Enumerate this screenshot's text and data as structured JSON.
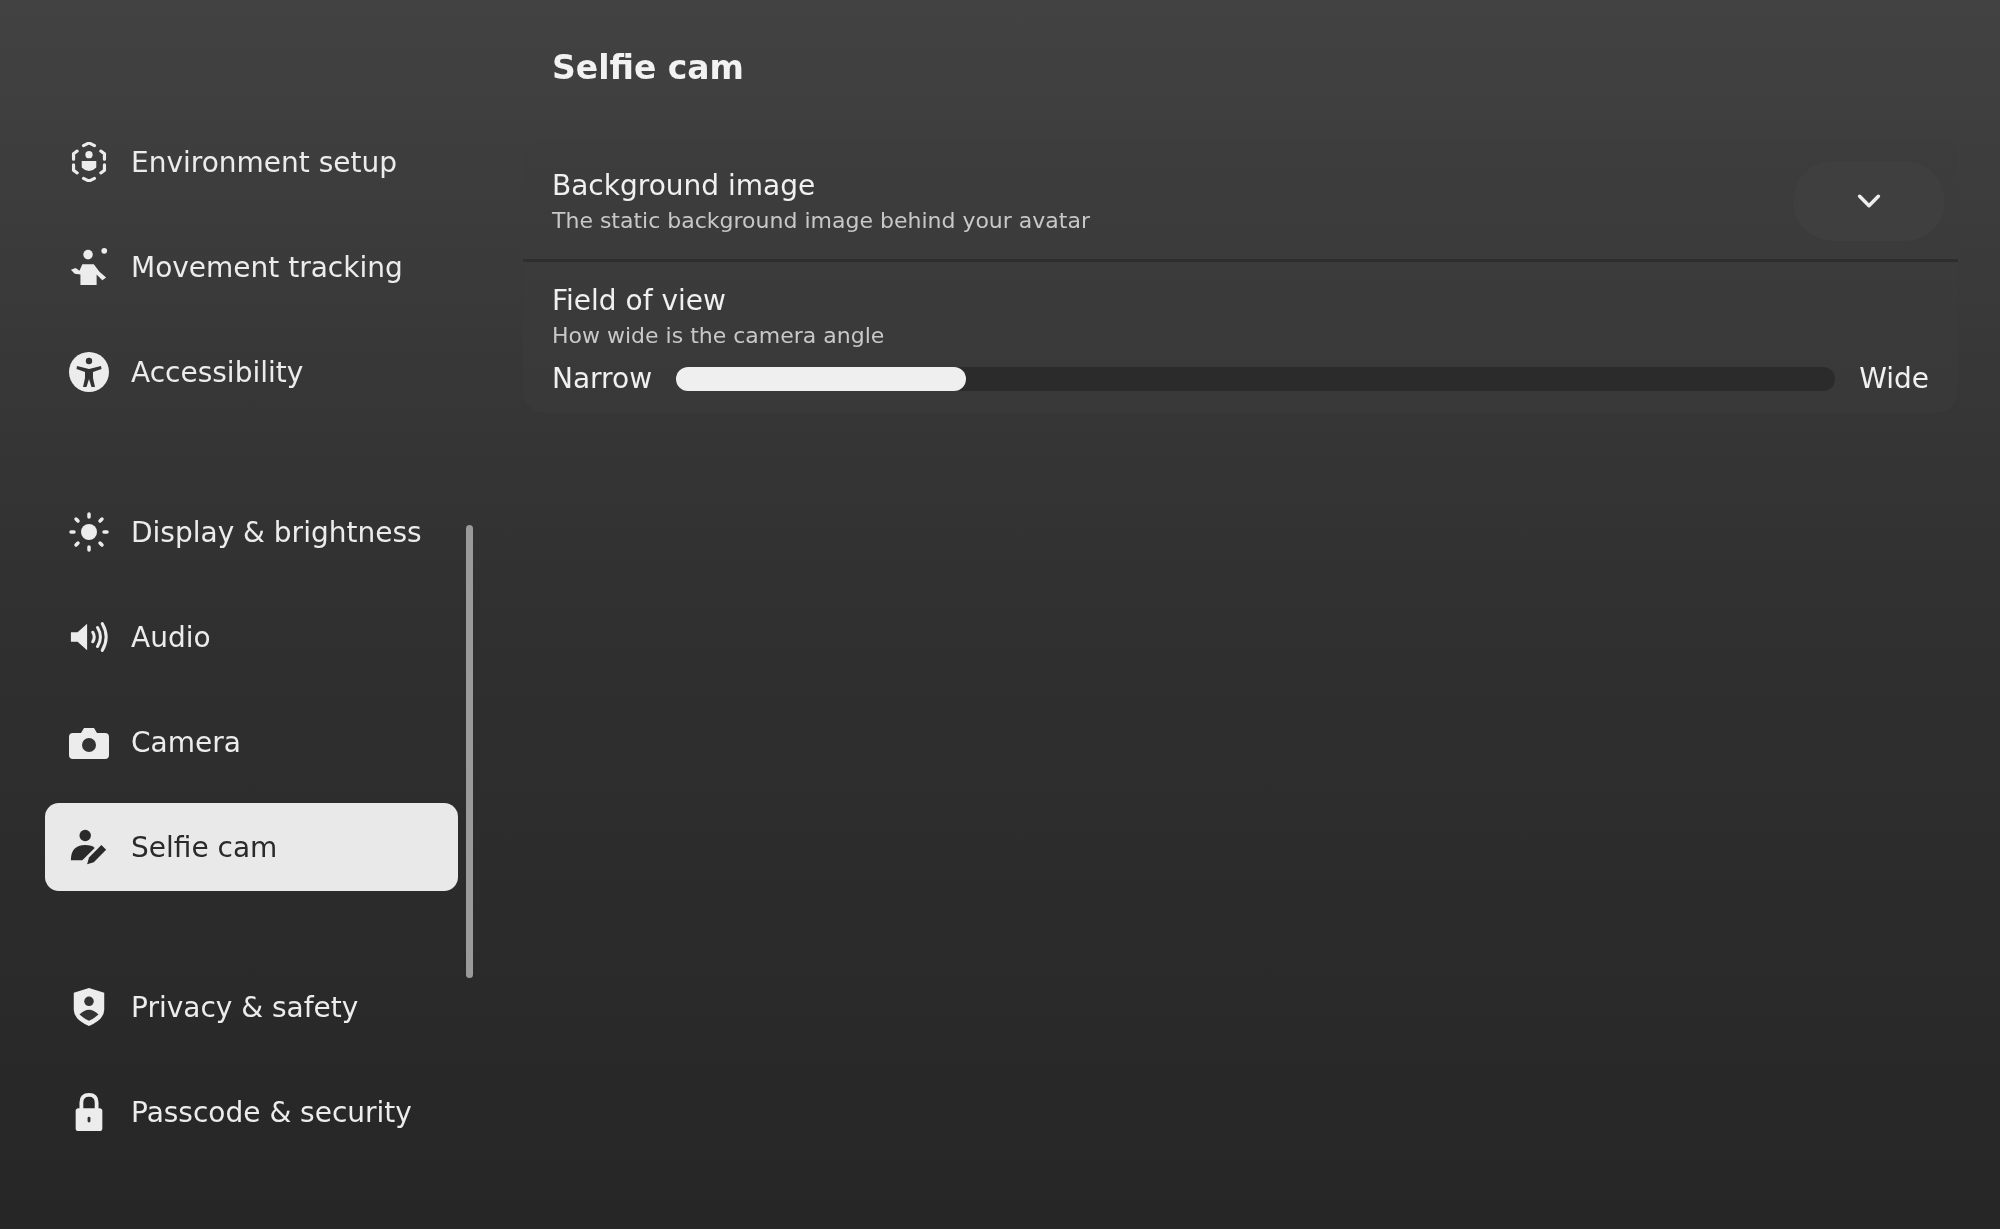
{
  "sidebar": {
    "groups": [
      {
        "items": [
          {
            "label": "Environment setup",
            "kind": "environment",
            "selected": false
          },
          {
            "label": "Movement tracking",
            "kind": "movement",
            "selected": false
          },
          {
            "label": "Accessibility",
            "kind": "accessibility",
            "selected": false
          }
        ]
      },
      {
        "items": [
          {
            "label": "Display & brightness",
            "kind": "sun",
            "selected": false
          },
          {
            "label": "Audio",
            "kind": "speaker",
            "selected": false
          },
          {
            "label": "Camera",
            "kind": "camera",
            "selected": false
          },
          {
            "label": "Selfie cam",
            "kind": "selfie",
            "selected": true
          }
        ]
      },
      {
        "items": [
          {
            "label": "Privacy & safety",
            "kind": "shield",
            "selected": false
          },
          {
            "label": "Passcode & security",
            "kind": "lock",
            "selected": false
          }
        ]
      }
    ]
  },
  "page": {
    "title": "Selfie cam",
    "settings": [
      {
        "kind": "dropdown",
        "title": "Background image",
        "description": "The static background image behind your avatar"
      },
      {
        "kind": "slider",
        "title": "Field of view",
        "description": "How wide is the camera angle",
        "min_label": "Narrow",
        "max_label": "Wide",
        "level": 0.25
      }
    ]
  }
}
